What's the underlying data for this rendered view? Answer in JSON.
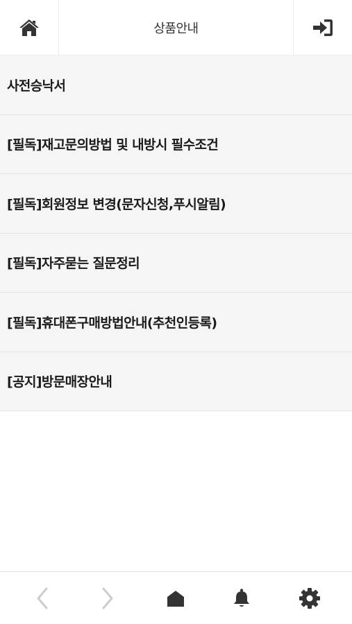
{
  "header": {
    "title": "상품안내",
    "home_icon": "home-icon",
    "login_icon": "sign-in-icon"
  },
  "list": {
    "items": [
      {
        "label": "사전승낙서"
      },
      {
        "label": "[필독]재고문의방법 및 내방시 필수조건"
      },
      {
        "label": "[필독]회원정보 변경(문자신청,푸시알림)"
      },
      {
        "label": "[필독]자주묻는 질문정리"
      },
      {
        "label": "[필독]휴대폰구매방법안내(추천인등록)"
      },
      {
        "label": "[공지]방문매장안내"
      }
    ]
  },
  "bottom_nav": {
    "icons": [
      "back-arrow-icon",
      "forward-arrow-icon",
      "home-icon",
      "bell-icon",
      "gear-icon"
    ]
  },
  "colors": {
    "icon_dark": "#333333",
    "icon_disabled": "#cccccc",
    "item_bg": "#f5f5f5",
    "divider": "#e4e4e4"
  }
}
